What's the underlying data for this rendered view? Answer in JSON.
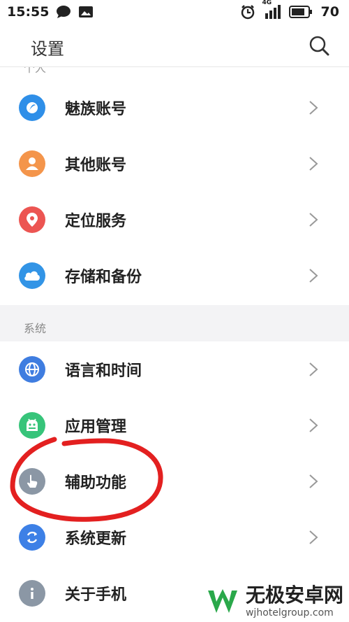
{
  "status_bar": {
    "time": "15:55",
    "network": "4G",
    "battery": "70"
  },
  "header": {
    "title": "设置"
  },
  "sections": {
    "personal_peek": "个人",
    "personal": [
      {
        "label": "魅族账号",
        "icon": "flyme-account-icon",
        "color": "#2f8fe8"
      },
      {
        "label": "其他账号",
        "icon": "person-icon",
        "color": "#f4954b"
      },
      {
        "label": "定位服务",
        "icon": "location-pin-icon",
        "color": "#ec5552"
      },
      {
        "label": "存储和备份",
        "icon": "cloud-icon",
        "color": "#3294e6"
      }
    ],
    "system_title": "系统",
    "system": [
      {
        "label": "语言和时间",
        "icon": "globe-icon",
        "color": "#3f7de0"
      },
      {
        "label": "应用管理",
        "icon": "android-icon",
        "color": "#37c47a"
      },
      {
        "label": "辅助功能",
        "icon": "hand-pointer-icon",
        "color": "#8b97a5"
      },
      {
        "label": "系统更新",
        "icon": "refresh-icon",
        "color": "#3d80e6"
      },
      {
        "label": "关于手机",
        "icon": "info-icon",
        "color": "#8b97a5"
      }
    ]
  },
  "annotation": {
    "color": "#e32020"
  },
  "watermark": {
    "main": "无极安卓网",
    "sub": "wjhotelgroup.com"
  }
}
